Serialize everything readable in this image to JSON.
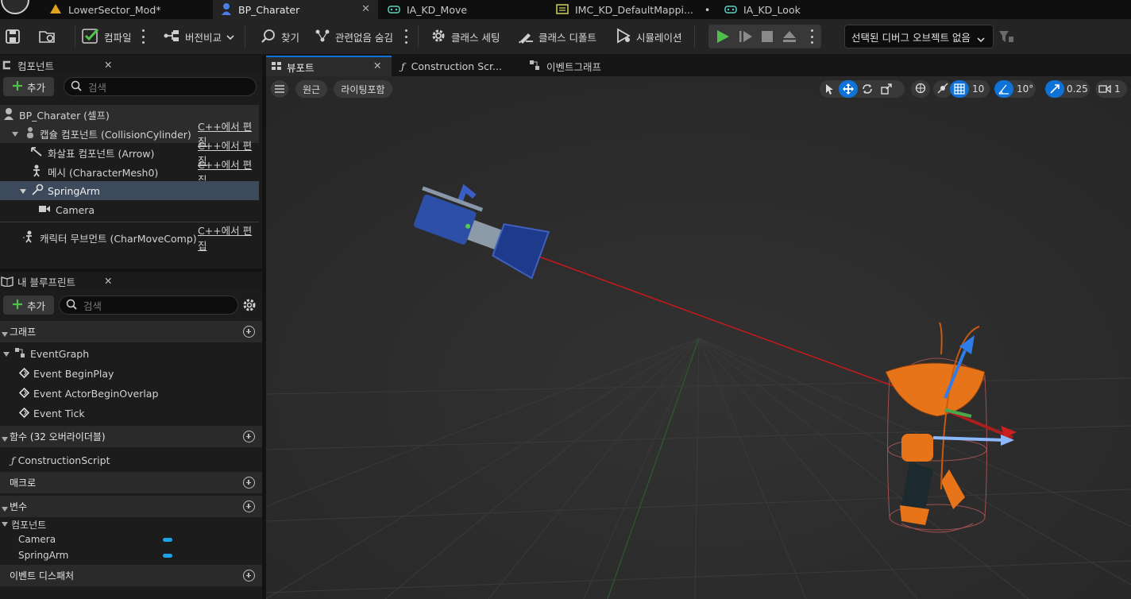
{
  "tabs": [
    {
      "label": "LowerSector_Mod*"
    },
    {
      "label": "BP_Charater"
    },
    {
      "label": "IA_KD_Move"
    },
    {
      "label": "IMC_KD_DefaultMappi...",
      "suffix": "•"
    },
    {
      "label": "IA_KD_Look"
    }
  ],
  "toolbar": {
    "compile": "컴파일",
    "diff": "버전비교",
    "find": "찾기",
    "hide_unrelated": "관련없음 숨김",
    "class_settings": "클래스 세팅",
    "class_defaults": "클래스 디폴트",
    "simulation": "시뮬레이션",
    "debug_object": "선택된 디버그 오브젝트 없음"
  },
  "components_panel": {
    "title": "컴포넌트",
    "add_label": "추가",
    "search_placeholder": "검색",
    "root": "BP_Charater (셀프)",
    "edit_cpp": "C++에서 편집",
    "items": [
      {
        "label": "캡슐 컴포넌트 (CollisionCylinder)"
      },
      {
        "label": "화살표 컴포넌트 (Arrow)"
      },
      {
        "label": "메시 (CharacterMesh0)"
      },
      {
        "label": "SpringArm"
      },
      {
        "label": "Camera"
      },
      {
        "label": "캐릭터 무브먼트 (CharMoveComp)"
      }
    ]
  },
  "blueprint_panel": {
    "title": "내 블루프린트",
    "add_label": "추가",
    "search_placeholder": "검색",
    "graph_section": "그래프",
    "event_graph": "EventGraph",
    "events": [
      "Event BeginPlay",
      "Event ActorBeginOverlap",
      "Event Tick"
    ],
    "functions_section": "함수 (32 오버라이더블)",
    "construction_script": "ConstructionScript",
    "macros_section": "매크로",
    "variables_section": "변수",
    "components_category": "컴포넌트",
    "variables": [
      "Camera",
      "SpringArm"
    ],
    "dispatchers_section": "이벤트 디스패처"
  },
  "editor_tabs": {
    "viewport": "뷰포트",
    "construction": "Construction Scr...",
    "event_graph": "이벤트그래프"
  },
  "viewport": {
    "perspective": "원근",
    "lighting": "라이팅포함",
    "grid_snap": "10",
    "rotation_snap": "10°",
    "scale_snap": "0.25",
    "camera_speed": "1"
  },
  "colors": {
    "accent": "#0e72d6",
    "play_green": "#4fc04a",
    "variable_pill": "#1fa3e8",
    "selected_row": "#3d4a5c"
  }
}
